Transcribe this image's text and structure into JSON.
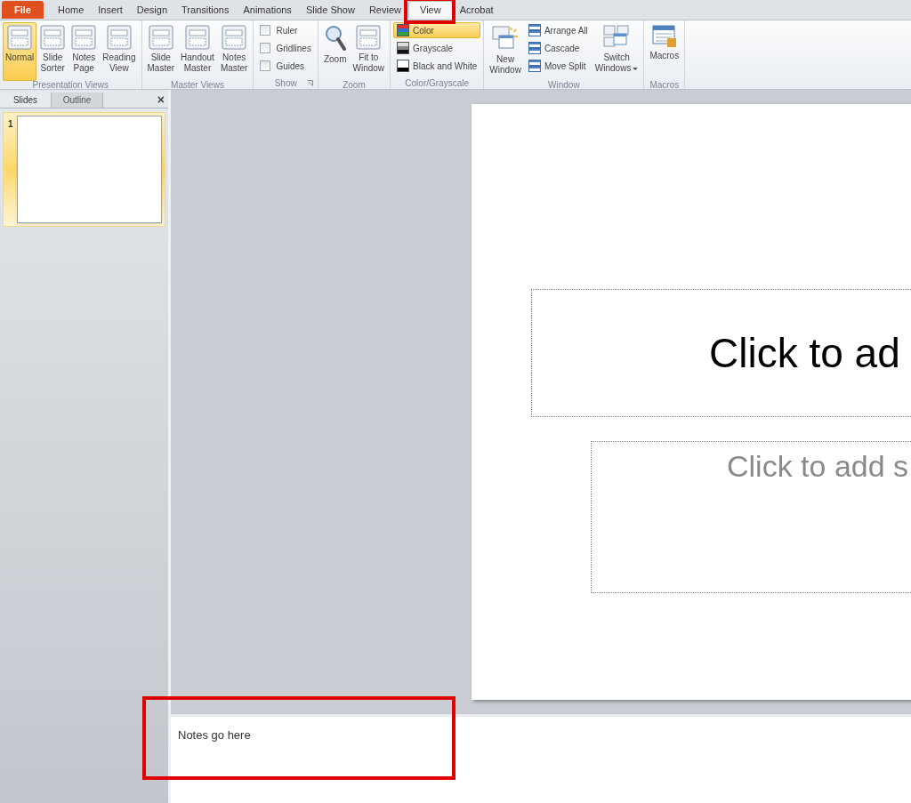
{
  "ribbon_tabs": [
    {
      "label": "File",
      "kind": "file",
      "selected": false,
      "highlighted": false
    },
    {
      "label": "Home",
      "kind": "tab",
      "selected": false,
      "highlighted": false
    },
    {
      "label": "Insert",
      "kind": "tab",
      "selected": false,
      "highlighted": false
    },
    {
      "label": "Design",
      "kind": "tab",
      "selected": false,
      "highlighted": false
    },
    {
      "label": "Transitions",
      "kind": "tab",
      "selected": false,
      "highlighted": false
    },
    {
      "label": "Animations",
      "kind": "tab",
      "selected": false,
      "highlighted": false
    },
    {
      "label": "Slide Show",
      "kind": "tab",
      "selected": false,
      "highlighted": false
    },
    {
      "label": "Review",
      "kind": "tab",
      "selected": false,
      "highlighted": false
    },
    {
      "label": "View",
      "kind": "tab",
      "selected": true,
      "highlighted": true
    },
    {
      "label": "Acrobat",
      "kind": "tab",
      "selected": false,
      "highlighted": false
    }
  ],
  "ribbon_groups": [
    {
      "label": "Presentation Views",
      "columns": [
        [
          {
            "kind": "large",
            "label": "Normal",
            "selected": true
          }
        ],
        [
          {
            "kind": "large",
            "label": "Slide\nSorter",
            "selected": false
          }
        ],
        [
          {
            "kind": "large",
            "label": "Notes\nPage",
            "selected": false
          }
        ],
        [
          {
            "kind": "large",
            "label": "Reading\nView",
            "selected": false
          }
        ]
      ]
    },
    {
      "label": "Master Views",
      "columns": [
        [
          {
            "kind": "large",
            "label": "Slide\nMaster",
            "selected": false
          }
        ],
        [
          {
            "kind": "large",
            "label": "Handout\nMaster",
            "selected": false
          }
        ],
        [
          {
            "kind": "large",
            "label": "Notes\nMaster",
            "selected": false
          }
        ]
      ]
    },
    {
      "label": "Show",
      "launcher": true,
      "columns": [
        [
          {
            "kind": "checkbox",
            "label": "Ruler",
            "checked": false
          },
          {
            "kind": "checkbox",
            "label": "Gridlines",
            "checked": false
          },
          {
            "kind": "checkbox",
            "label": "Guides",
            "checked": false
          }
        ]
      ]
    },
    {
      "label": "Zoom",
      "columns": [
        [
          {
            "kind": "large",
            "label": "Zoom",
            "selected": false
          }
        ],
        [
          {
            "kind": "large",
            "label": "Fit to\nWindow",
            "selected": false
          }
        ]
      ]
    },
    {
      "label": "Color/Grayscale",
      "columns": [
        [
          {
            "kind": "small",
            "label": "Color",
            "selected": true
          },
          {
            "kind": "small",
            "label": "Grayscale",
            "selected": false
          },
          {
            "kind": "small",
            "label": "Black and White",
            "selected": false
          }
        ]
      ]
    },
    {
      "label": "Window",
      "columns": [
        [
          {
            "kind": "large",
            "label": "New\nWindow",
            "selected": false
          }
        ],
        [
          {
            "kind": "small",
            "label": "Arrange All",
            "selected": false
          },
          {
            "kind": "small",
            "label": "Cascade",
            "selected": false
          },
          {
            "kind": "small",
            "label": "Move Split",
            "selected": false
          }
        ],
        [
          {
            "kind": "large",
            "label": "Switch\nWindows",
            "dropdown": true,
            "selected": false
          }
        ]
      ]
    },
    {
      "label": "Macros",
      "columns": [
        [
          {
            "kind": "large",
            "label": "Macros",
            "selected": false
          }
        ]
      ]
    }
  ],
  "side_pane": {
    "tabs": [
      {
        "label": "Slides",
        "selected": true
      },
      {
        "label": "Outline",
        "selected": false
      }
    ],
    "close": "×",
    "thumbnails": [
      {
        "number": "1",
        "selected": true
      }
    ]
  },
  "slide": {
    "title_placeholder": "Click to ad",
    "subtitle_placeholder": "Click to add s"
  },
  "notes": {
    "text": "Notes go here",
    "highlighted": true
  }
}
